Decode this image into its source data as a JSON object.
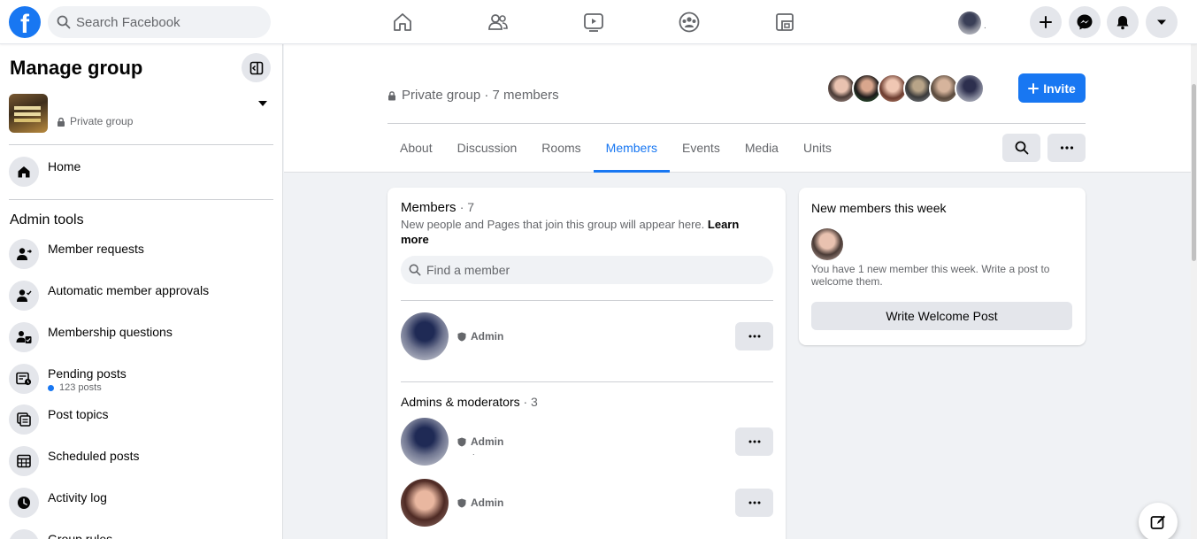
{
  "topbar": {
    "logo_letter": "f",
    "search_placeholder": "Search Facebook",
    "nav_icons": [
      "home-icon",
      "friends-icon",
      "watch-icon",
      "groups-icon",
      "gaming-icon"
    ],
    "profile_dot": ".",
    "action_icons": [
      "plus-icon",
      "messenger-icon",
      "notifications-icon",
      "account-menu-icon"
    ]
  },
  "sidebar": {
    "title": "Manage group",
    "group_privacy": "Private group",
    "home_label": "Home",
    "admin_tools_heading": "Admin tools",
    "admin_tools": [
      {
        "label": "Member requests",
        "icon": "member-requests-icon"
      },
      {
        "label": "Automatic member approvals",
        "icon": "auto-approvals-icon"
      },
      {
        "label": "Membership questions",
        "icon": "membership-questions-icon"
      },
      {
        "label": "Pending posts",
        "sub": "123 posts",
        "icon": "pending-posts-icon"
      },
      {
        "label": "Post topics",
        "icon": "post-topics-icon"
      },
      {
        "label": "Scheduled posts",
        "icon": "scheduled-posts-icon"
      },
      {
        "label": "Activity log",
        "icon": "activity-log-icon"
      },
      {
        "label": "Group rules",
        "icon": "group-rules-icon"
      }
    ]
  },
  "header": {
    "privacy_line": "Private group · 7 members",
    "invite_label": "Invite",
    "tabs": [
      "About",
      "Discussion",
      "Rooms",
      "Members",
      "Events",
      "Media",
      "Units"
    ],
    "active_tab": "Members"
  },
  "members_card": {
    "title": "Members",
    "count": "· 7",
    "description": "New people and Pages that join this group will appear here.",
    "learn_more": "Learn more",
    "find_placeholder": "Find a member",
    "top_member_role": "Admin",
    "admins_heading": "Admins & moderators",
    "admins_count": "· 3",
    "admins": [
      {
        "role": "Admin",
        "sub": "."
      },
      {
        "role": "Admin"
      }
    ]
  },
  "new_members_card": {
    "title": "New members this week",
    "text": "You have 1 new member this week. Write a post to welcome them.",
    "button_label": "Write Welcome Post"
  },
  "colors": {
    "brand": "#1877f2",
    "background": "#f0f2f5",
    "secondary_text": "#65676b"
  }
}
